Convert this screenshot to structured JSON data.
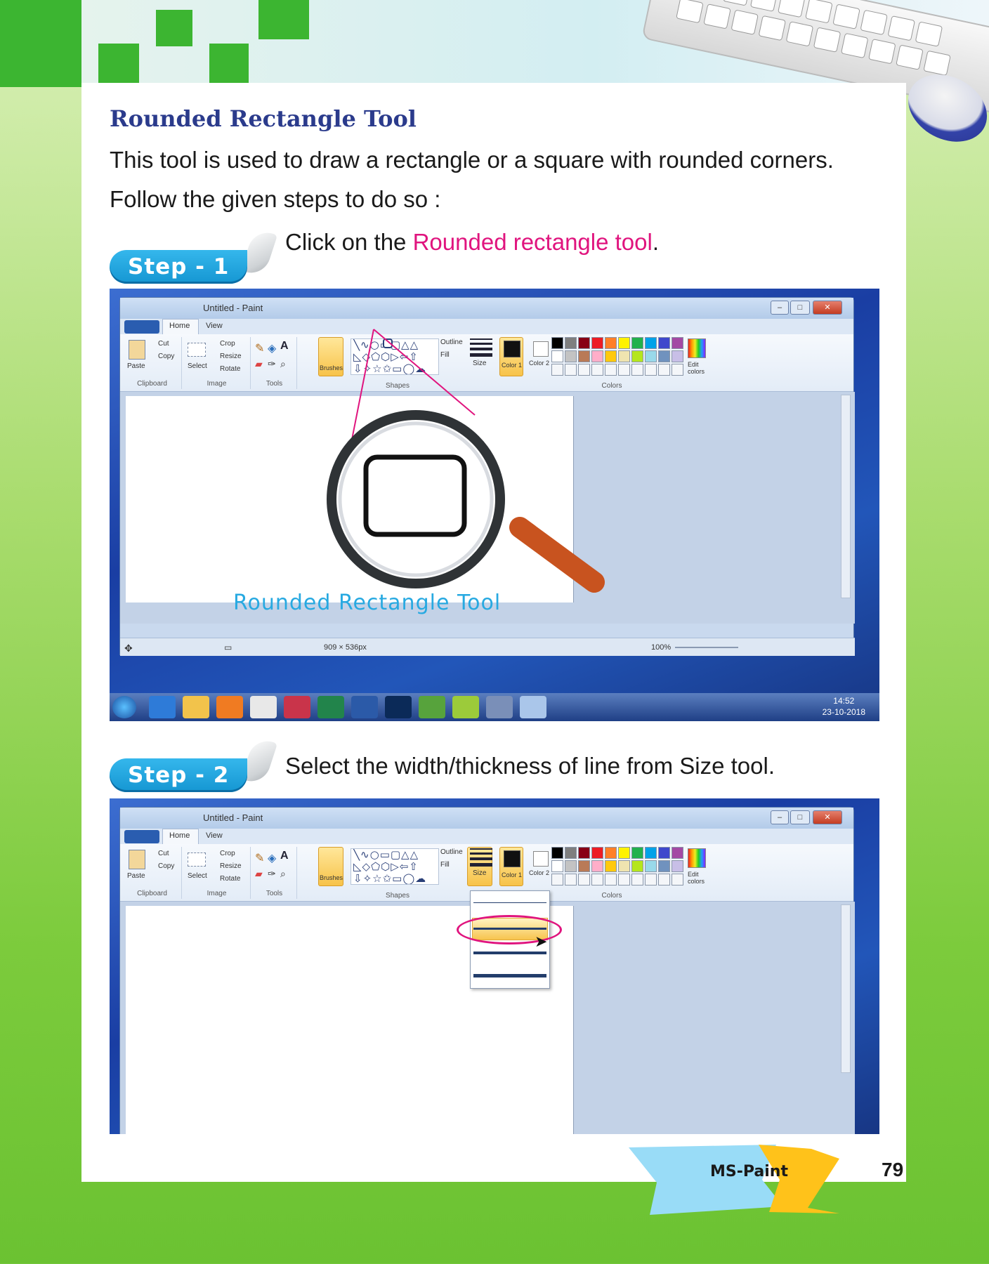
{
  "heading": "Rounded Rectangle Tool",
  "intro": [
    "This tool is used to draw a rectangle or a square with rounded corners.",
    "Follow the given steps to do so :"
  ],
  "steps": [
    {
      "label": "Step - 1",
      "text_before": "Click on the ",
      "highlight": "Rounded rectangle tool",
      "text_after": "."
    },
    {
      "label": "Step - 2",
      "text": "Select the width/thickness of line from Size tool."
    }
  ],
  "paint": {
    "window_title": "Untitled - Paint",
    "tabs": [
      "Home",
      "View"
    ],
    "clipboard": {
      "paste": "Paste",
      "cut": "Cut",
      "copy": "Copy",
      "group": "Clipboard"
    },
    "image": {
      "select": "Select",
      "crop": "Crop",
      "resize": "Resize",
      "rotate": "Rotate",
      "group": "Image"
    },
    "tools_group": "Tools",
    "brushes": "Brushes",
    "shapes": {
      "outline": "Outline",
      "fill": "Fill",
      "group": "Shapes"
    },
    "size": "Size",
    "color1": "Color 1",
    "color2": "Color 2",
    "colors_group": "Colors",
    "edit_colors": "Edit colors",
    "canvas_size": "909 × 536px",
    "zoom": "100%",
    "callout_label": "Rounded Rectangle Tool",
    "clock_time": "14:52",
    "clock_date": "23-10-2018",
    "palette_row1": [
      "#000000",
      "#7f7f7f",
      "#880015",
      "#ed1c24",
      "#ff7f27",
      "#fff200",
      "#22b14c",
      "#00a2e8",
      "#3f48cc",
      "#a349a4"
    ],
    "palette_row2": [
      "#ffffff",
      "#c3c3c3",
      "#b97a57",
      "#ffaec9",
      "#ffc90e",
      "#efe4b0",
      "#b5e61d",
      "#99d9ea",
      "#7092be",
      "#c8bfe7"
    ]
  },
  "footer": {
    "chapter": "MS-Paint",
    "page_number": "79"
  },
  "colors": {
    "heading": "#2b3b8c",
    "highlight": "#e0147e",
    "step_badge": "#1596d2",
    "banner_green": "#3cb531"
  }
}
